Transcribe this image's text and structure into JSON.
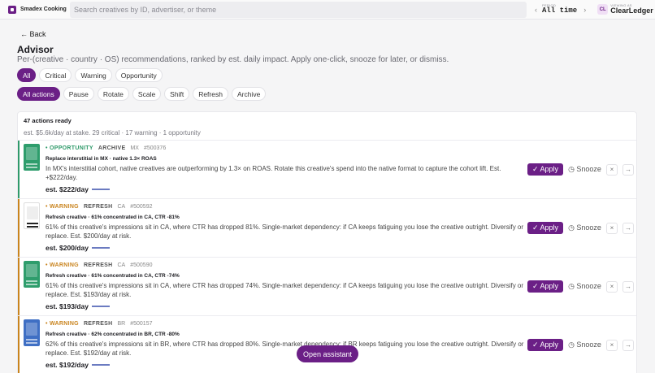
{
  "topbar": {
    "brand": "Smadex Cooking",
    "search_placeholder": "Search creatives by ID, advertiser, or theme",
    "period_caption": "PERIOD",
    "period_value": "All time",
    "viewing_caption": "VIEWING AS",
    "viewing_initials": "CL",
    "viewing_name": "ClearLedger"
  },
  "page": {
    "back": "← Back",
    "title": "Advisor",
    "subtitle": "Per-(creative · country · OS) recommendations, ranked by est. daily impact. Apply one-click, snooze for later, or dismiss."
  },
  "severity_filters": [
    "All",
    "Critical",
    "Warning",
    "Opportunity"
  ],
  "action_filters": [
    "All actions",
    "Pause",
    "Rotate",
    "Scale",
    "Shift",
    "Refresh",
    "Archive"
  ],
  "summary": {
    "count": "47 actions ready",
    "meta": "est. $5.6k/day at stake. 29 critical · 17 warning · 1 opportunity"
  },
  "colors": {
    "accent": "#6b1f86",
    "opportunity": "#2f9a6a",
    "warning": "#c9841e"
  },
  "recommendations": [
    {
      "severity": "• OPPORTUNITY",
      "action": "ARCHIVE",
      "geo": "MX",
      "id": "#500376",
      "headline": "Replace interstitial in MX · native 1.3× ROAS",
      "desc": "In MX's interstitial cohort, native creatives are outperforming by 1.3× on ROAS. Rotate this creative's spend into the native format to capture the cohort lift. Est. +$222/day.",
      "impact": "est. $222/day",
      "apply": "✓ Apply",
      "snooze": "◷ Snooze"
    },
    {
      "severity": "• WARNING",
      "action": "REFRESH",
      "geo": "CA",
      "id": "#500592",
      "headline": "Refresh creative · 61% concentrated in CA, CTR -81%",
      "desc": "61% of this creative's impressions sit in CA, where CTR has dropped 81%. Single-market dependency: if CA keeps fatiguing you lose the creative outright. Diversify or replace. Est. $200/day at risk.",
      "impact": "est. $200/day",
      "apply": "✓ Apply",
      "snooze": "◷ Snooze"
    },
    {
      "severity": "• WARNING",
      "action": "REFRESH",
      "geo": "CA",
      "id": "#500590",
      "headline": "Refresh creative · 61% concentrated in CA, CTR -74%",
      "desc": "61% of this creative's impressions sit in CA, where CTR has dropped 74%. Single-market dependency: if CA keeps fatiguing you lose the creative outright. Diversify or replace. Est. $193/day at risk.",
      "impact": "est. $193/day",
      "apply": "✓ Apply",
      "snooze": "◷ Snooze"
    },
    {
      "severity": "• WARNING",
      "action": "REFRESH",
      "geo": "BR",
      "id": "#500157",
      "headline": "Refresh creative · 62% concentrated in BR, CTR -80%",
      "desc": "62% of this creative's impressions sit in BR, where CTR has dropped 80%. Single-market dependency: if BR keeps fatiguing you lose the creative outright. Diversify or replace. Est. $192/day at risk.",
      "impact": "est. $192/day",
      "apply": "✓ Apply",
      "snooze": "◷ Snooze"
    }
  ],
  "assistant_button": "Open assistant"
}
